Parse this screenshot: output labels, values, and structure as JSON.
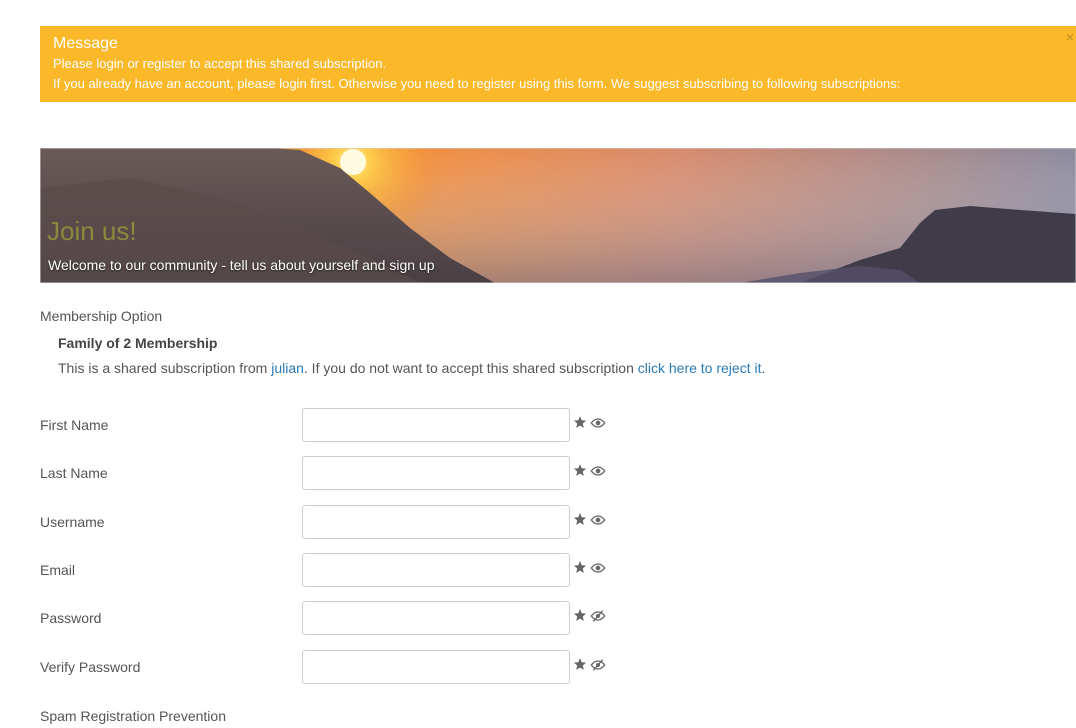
{
  "alert": {
    "title": "Message",
    "line1": "Please login or register to accept this shared subscription.",
    "line2": "If you already have an account, please login first. Otherwise you need to register using this form. We suggest subscribing to following subscriptions:",
    "close_label": "×"
  },
  "banner": {
    "heading": "Join us!",
    "subheading": "Welcome to our community - tell us about yourself and sign up"
  },
  "membership": {
    "section_label": "Membership Option",
    "plan_name": "Family of 2 Membership",
    "desc_prefix": "This is a shared subscription from ",
    "shared_by": "julian",
    "desc_middle": ". If you do not want to accept this shared subscription ",
    "reject_link": "click here to reject it",
    "desc_suffix": "."
  },
  "fields": [
    {
      "label": "First Name",
      "value": "",
      "required_icon": "star-icon",
      "visibility_icon": "eye-icon"
    },
    {
      "label": "Last Name",
      "value": "",
      "required_icon": "star-icon",
      "visibility_icon": "eye-icon"
    },
    {
      "label": "Username",
      "value": "",
      "required_icon": "star-icon",
      "visibility_icon": "eye-icon"
    },
    {
      "label": "Email",
      "value": "",
      "required_icon": "star-icon",
      "visibility_icon": "eye-icon"
    },
    {
      "label": "Password",
      "value": "",
      "required_icon": "star-icon",
      "visibility_icon": "eye-slash-icon"
    },
    {
      "label": "Verify Password",
      "value": "",
      "required_icon": "star-icon",
      "visibility_icon": "eye-slash-icon"
    }
  ],
  "spam": {
    "section_label": "Spam Registration Prevention"
  },
  "colors": {
    "alert_bg": "#fbb829",
    "link": "#2a7ab8",
    "icon": "#666666"
  }
}
